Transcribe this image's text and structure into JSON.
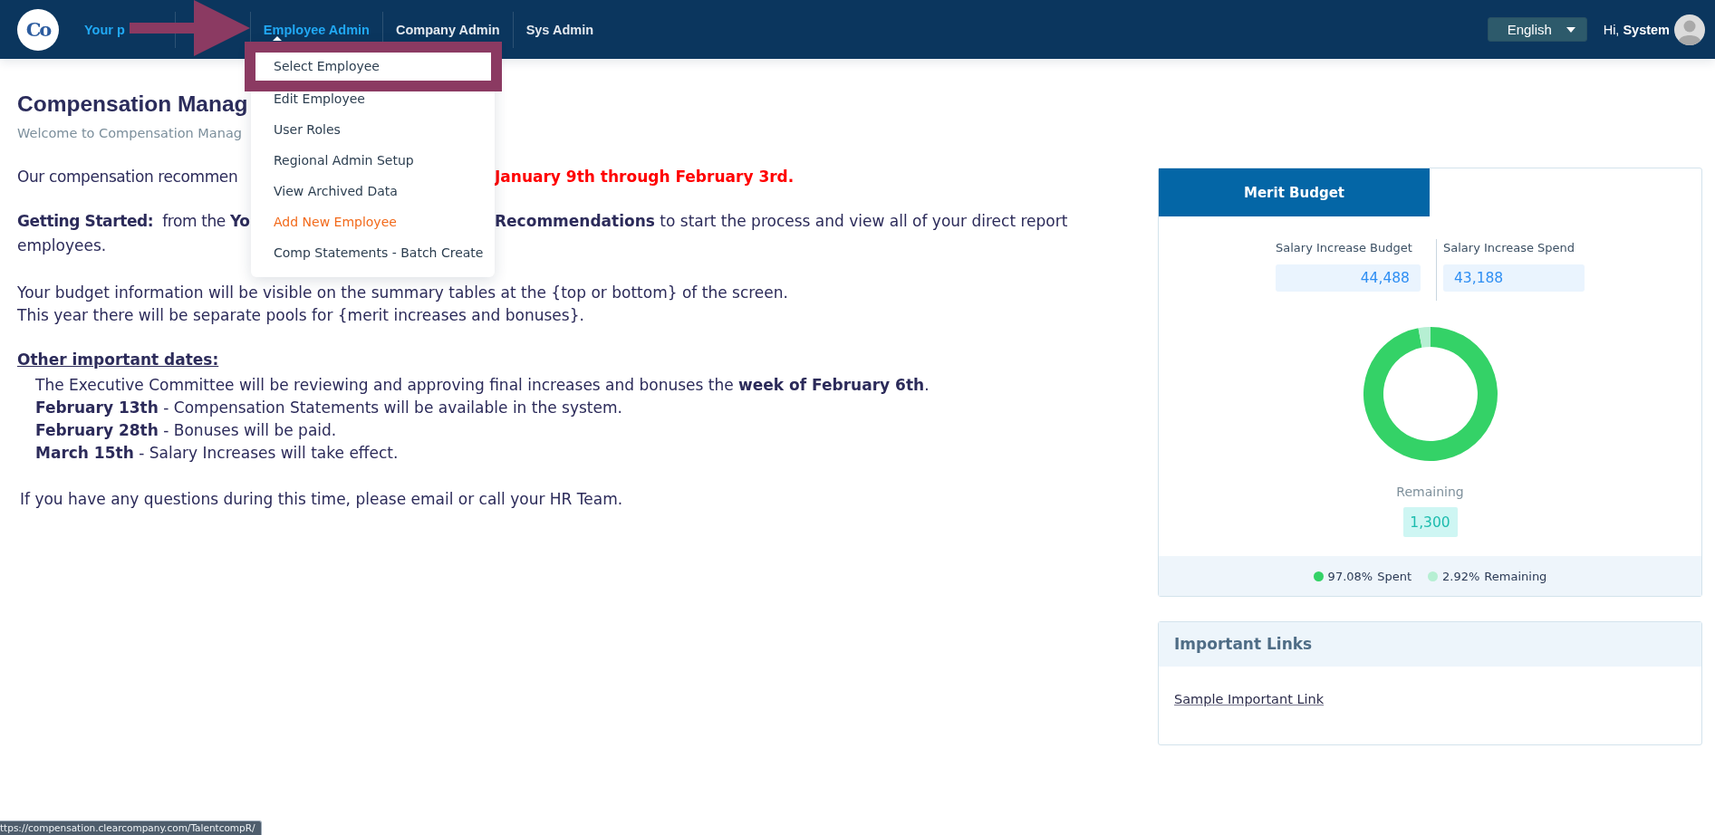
{
  "nav": {
    "logo": "Co",
    "items": [
      {
        "label": "Your p",
        "selected": true,
        "expanded": false
      },
      {
        "label": "Employee Admin",
        "selected": true,
        "expanded": true
      },
      {
        "label": "Company Admin",
        "selected": false,
        "expanded": false
      },
      {
        "label": "Sys Admin",
        "selected": false,
        "expanded": false
      }
    ],
    "language": "English",
    "greeting": "Hi, **System**"
  },
  "annotation_arrow": true,
  "menu": {
    "items": [
      {
        "label": "Select Employee",
        "highlighted": false,
        "outlined": true
      },
      {
        "label": "Edit Employee",
        "highlighted": false,
        "outlined": false
      },
      {
        "label": "User Roles",
        "highlighted": false,
        "outlined": false
      },
      {
        "label": "Regional Admin Setup",
        "highlighted": false,
        "outlined": false
      },
      {
        "label": "View Archived Data",
        "highlighted": false,
        "outlined": false
      },
      {
        "label": "Add New Employee",
        "highlighted": true,
        "outlined": false
      },
      {
        "label": "Comp Statements - Batch Create",
        "highlighted": false,
        "outlined": false
      }
    ]
  },
  "page": {
    "title": "Compensation Manag",
    "subtitle": "Welcome to Compensation Manag",
    "intro": {
      "lead": "Our compensation recommen",
      "deadline": "January 9th through February 3rd."
    },
    "getting_started": {
      "lead": "**Getting Started:**  from the **Yo**",
      "rest": "**Recommendations** to start the process and view all of your direct report",
      "continuation": "employees."
    },
    "budget_lines": [
      "Your budget information will be visible on the summary tables at the {top or bottom} of the screen.",
      "This year there will be separate pools for {merit increases and bonuses}."
    ],
    "dates_heading": "Other important dates:",
    "dates": [
      "The Executive Committee will be reviewing and approving final increases and bonuses the **week of February 6th**.",
      "**February 13th** - Compensation Statements will be available in the system.",
      "**February 28th** - Bonuses will be paid.",
      "**March 15th** - Salary Increases will take effect."
    ],
    "closing": "If you have any questions during this time, please email or call your HR Team."
  },
  "merit_budget": {
    "tabs": [
      {
        "label": "Merit Budget",
        "selected": true
      }
    ],
    "stats": [
      {
        "label": "Salary Increase Budget",
        "value": "44,488"
      },
      {
        "label": "Salary Increase Spend",
        "value": "43,188"
      }
    ],
    "chart_data": {
      "type": "donut",
      "categories": [
        "Spent",
        "Remaining"
      ],
      "values": [
        97.08,
        2.92
      ]
    },
    "remaining_label": "Remaining",
    "remaining_value": "1,300",
    "legend": [
      {
        "share": "97.08%",
        "color": "#34d267"
      },
      {
        "share": "2.92%",
        "color": "#b6efd3"
      }
    ]
  },
  "important_links": {
    "title": "Important Links",
    "links": [
      "Sample Important Link"
    ]
  },
  "status_url": "ttps://compensation.clearcompany.com/TalentcompR/"
}
